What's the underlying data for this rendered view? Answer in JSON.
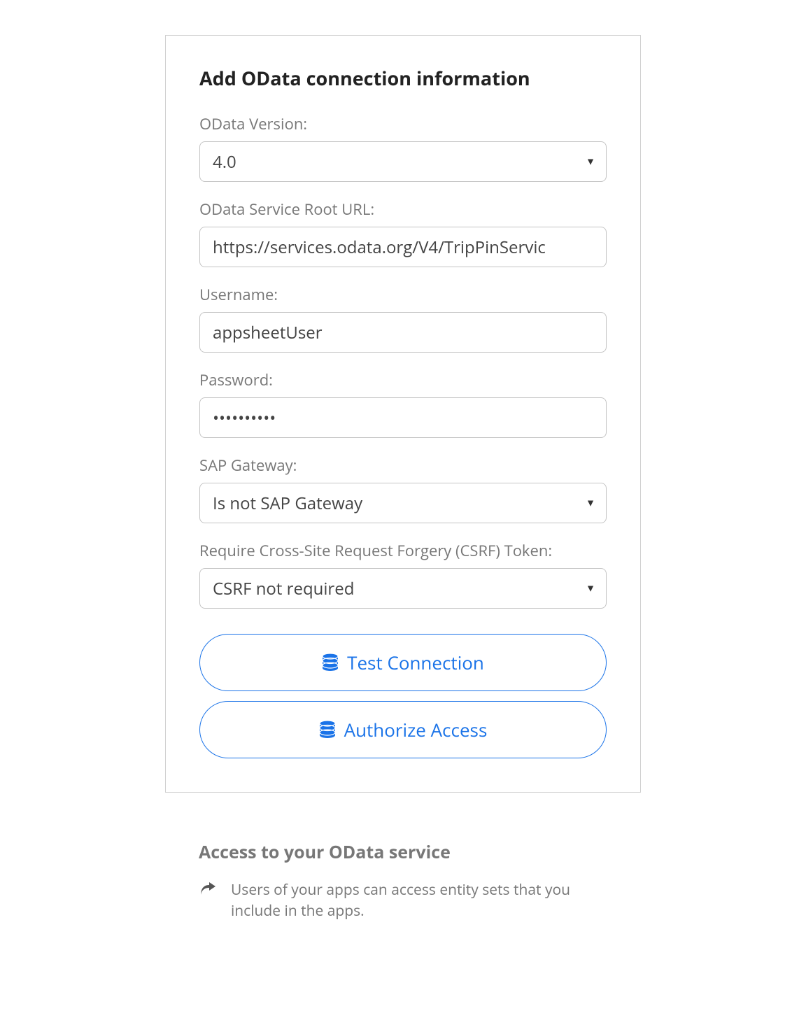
{
  "card": {
    "title": "Add OData connection information",
    "fields": {
      "odata_version": {
        "label": "OData Version:",
        "value": "4.0"
      },
      "root_url": {
        "label": "OData Service Root URL:",
        "value": "https://services.odata.org/V4/TripPinServic"
      },
      "username": {
        "label": "Username:",
        "value": "appsheetUser"
      },
      "password": {
        "label": "Password:",
        "value": "••••••••••"
      },
      "sap_gateway": {
        "label": "SAP Gateway:",
        "value": "Is not SAP Gateway"
      },
      "csrf": {
        "label": "Require Cross-Site Request Forgery (CSRF) Token:",
        "value": "CSRF not required"
      }
    },
    "buttons": {
      "test_connection": "Test Connection",
      "authorize_access": "Authorize Access"
    }
  },
  "info": {
    "title": "Access to your OData service",
    "text": "Users of your apps can access entity sets that you include in the apps."
  }
}
